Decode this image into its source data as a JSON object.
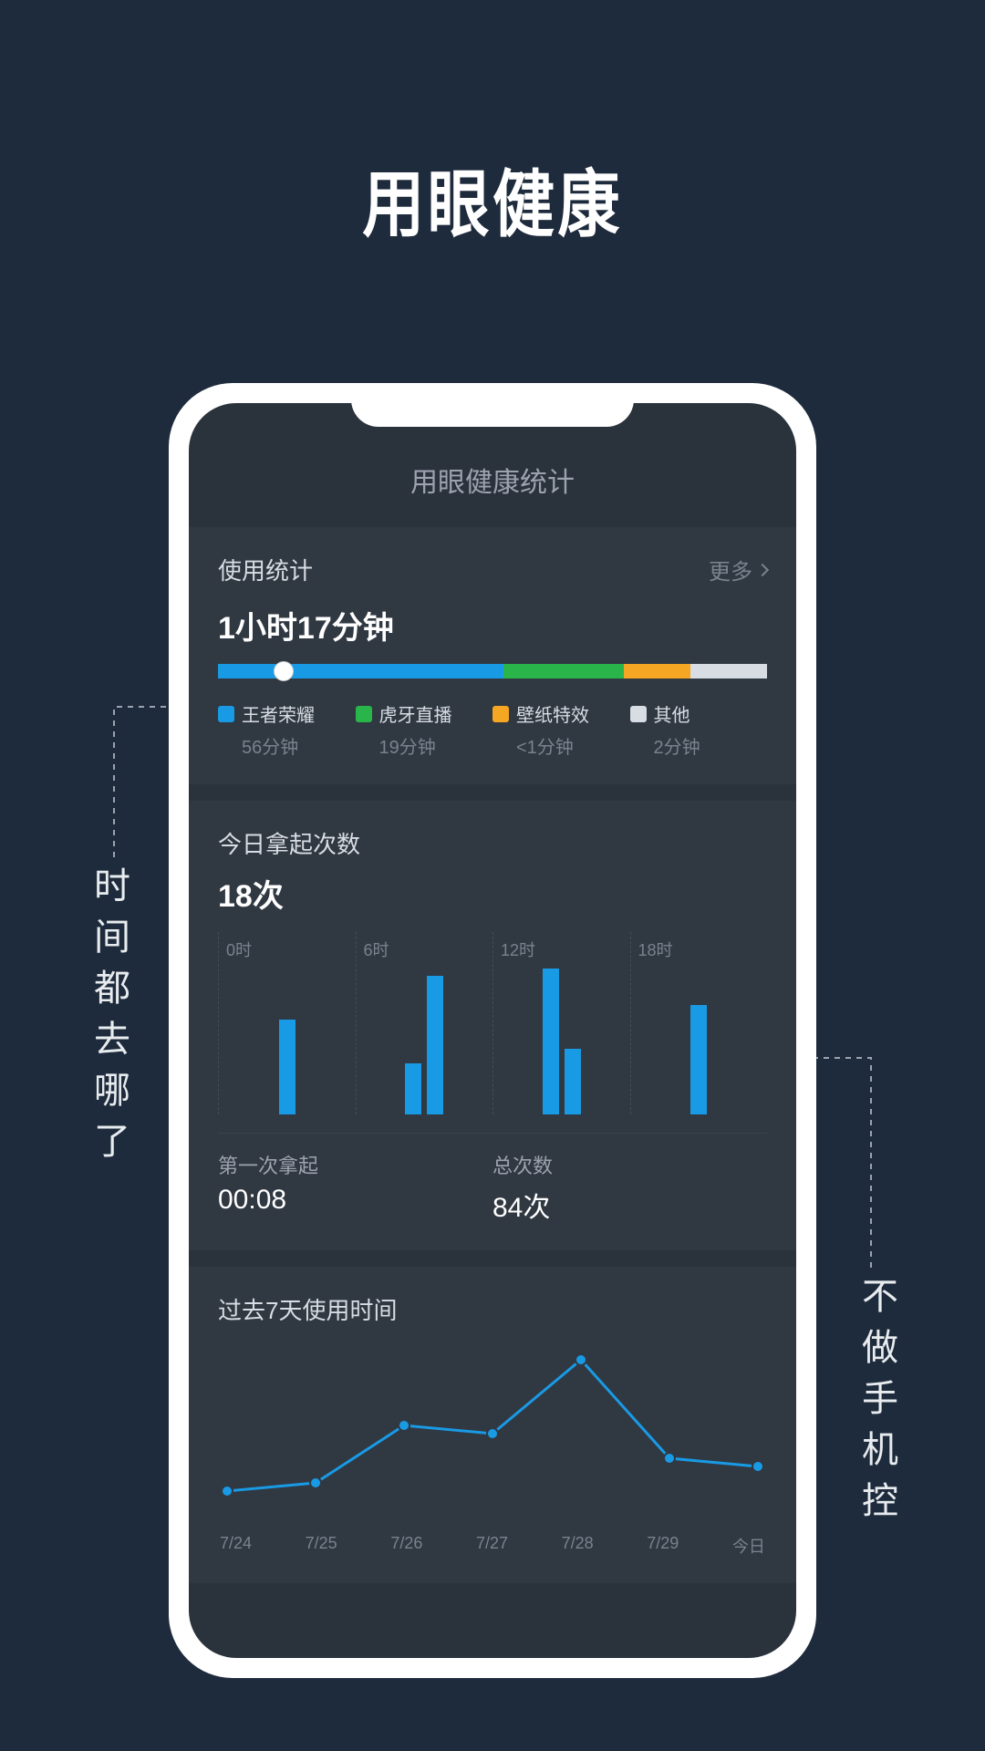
{
  "page_title": "用眼健康",
  "side_left_text": "时间都去哪了",
  "side_right_text": "不做手机控",
  "screen_header": "用眼健康统计",
  "usage_card": {
    "title": "使用统计",
    "more_label": "更多",
    "total_time": "1小时17分钟",
    "segments": [
      {
        "label": "王者荣耀",
        "value": "56分钟",
        "color": "#199ae4",
        "pct": 52
      },
      {
        "label": "虎牙直播",
        "value": "19分钟",
        "color": "#2ab54a",
        "pct": 22
      },
      {
        "label": "壁纸特效",
        "value": "<1分钟",
        "color": "#f5a623",
        "pct": 12
      },
      {
        "label": "其他",
        "value": "2分钟",
        "color": "#d8dde3",
        "pct": 14
      }
    ]
  },
  "pickup_card": {
    "title": "今日拿起次数",
    "count": "18次",
    "first_pickup_label": "第一次拿起",
    "first_pickup_value": "00:08",
    "total_label": "总次数",
    "total_value": "84次"
  },
  "weekly_card": {
    "title": "过去7天使用时间"
  },
  "chart_data": [
    {
      "type": "bar",
      "title": "今日拿起次数",
      "x_markers": [
        "0时",
        "6时",
        "12时",
        "18时"
      ],
      "series": [
        {
          "hour_block": 0,
          "bars": [
            65
          ]
        },
        {
          "hour_block": 6,
          "bars": [
            35,
            95
          ]
        },
        {
          "hour_block": 12,
          "bars": [
            100,
            45
          ]
        },
        {
          "hour_block": 18,
          "bars": [
            75
          ]
        }
      ],
      "ylim": [
        0,
        100
      ]
    },
    {
      "type": "line",
      "title": "过去7天使用时间",
      "categories": [
        "7/24",
        "7/25",
        "7/26",
        "7/27",
        "7/28",
        "7/29",
        "今日"
      ],
      "values": [
        15,
        20,
        55,
        50,
        95,
        35,
        30
      ],
      "ylim": [
        0,
        100
      ]
    }
  ]
}
